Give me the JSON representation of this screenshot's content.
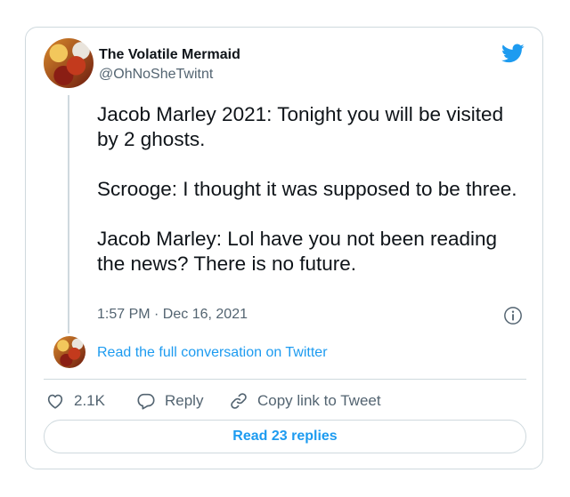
{
  "author": {
    "display_name": "The Volatile Mermaid",
    "handle": "@OhNoSheTwitnt"
  },
  "tweet": {
    "text": "Jacob Marley 2021: Tonight you will be visited by 2 ghosts.\n\nScrooge: I thought it was supposed to be three.\n\nJacob Marley: Lol have you not been reading the news? There is no future.",
    "timestamp": "1:57 PM · Dec 16, 2021"
  },
  "conversation_link": "Read the full conversation on Twitter",
  "actions": {
    "like_count": "2.1K",
    "reply_label": "Reply",
    "copy_label": "Copy link to Tweet"
  },
  "read_replies_label": "Read 23 replies",
  "colors": {
    "accent": "#1d9bf0",
    "muted": "#536471",
    "border": "#cfd9de",
    "text": "#0f1419"
  },
  "icons": [
    "twitter-bird-icon",
    "info-icon",
    "heart-icon",
    "reply-bubble-icon",
    "link-icon"
  ]
}
